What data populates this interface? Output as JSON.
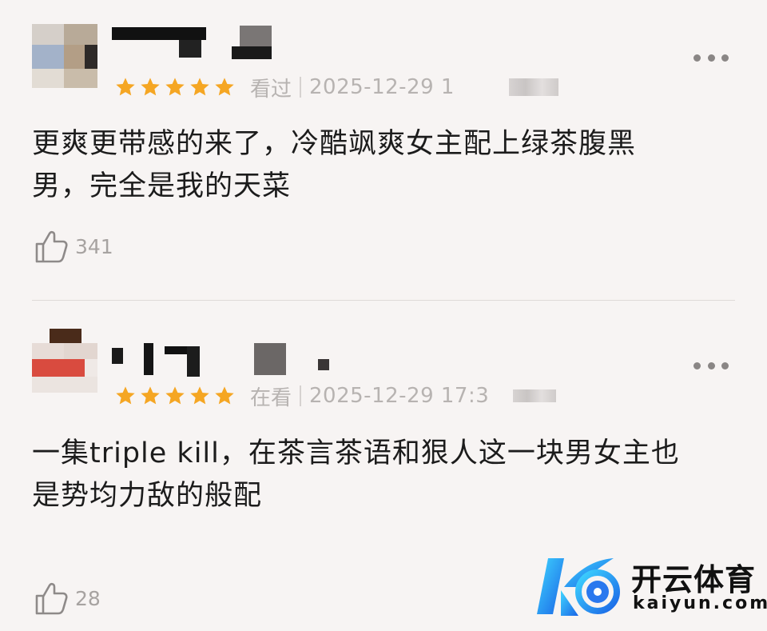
{
  "reviews": [
    {
      "rating_stars": 5,
      "status": "看过",
      "timestamp": "2025-12-29 1",
      "body_line1": "更爽更带感的来了，冷酷飒爽女主配上绿茶腹黑",
      "body_line2": "男，完全是我的天菜",
      "likes": "341"
    },
    {
      "rating_stars": 5,
      "status": "在看",
      "timestamp": "2025-12-29 17:3",
      "body_line1": "一集triple kill，在茶言茶语和狠人这一块男女主也",
      "body_line2": "是势均力敌的般配",
      "likes": "28"
    }
  ],
  "icons": {
    "star": "star-icon",
    "more": "more-options-icon",
    "like": "thumbs-up-icon"
  },
  "colors": {
    "star": "#f5a623",
    "muted_text": "#b7b3b1",
    "background": "#f7f4f3"
  },
  "watermark": {
    "brand_cn": "开云体育",
    "brand_en": "kaiyun.com"
  }
}
